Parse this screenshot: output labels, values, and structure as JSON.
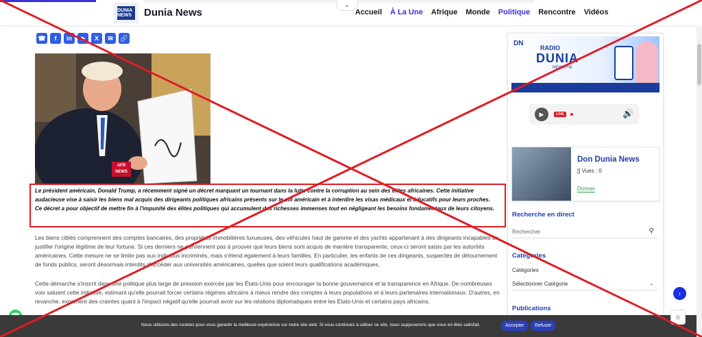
{
  "header": {
    "brand_name": "Dunia News",
    "logo_text": "DUNIA NEWS",
    "nav_items": [
      "Accueil",
      "À La Une",
      "Afrique",
      "Monde",
      "Politique",
      "Rencontre",
      "Vidéos"
    ],
    "active_items": [
      "À La Une",
      "Politique"
    ]
  },
  "share": {
    "icons": [
      "whatsapp-icon",
      "facebook-icon",
      "linkedin-icon",
      "telegram-icon",
      "x-icon",
      "email-icon",
      "link-icon"
    ]
  },
  "article": {
    "hero_badge": "AFR NEWS",
    "intro": "Le président américain, Donald Trump, a récemment signé un décret marquant un tournant dans la lutte contre la corruption au sein des élites africaines. Cette initiative audacieuse vise à saisir les biens mal acquis des dirigeants politiques africains présents sur le sol américain et à interdire les visas médicaux et éducatifs pour leurs proches. Ce décret a pour objectif de mettre fin à l'impunité des élites politiques qui accumulent des richesses immenses tout en négligeant les besoins fondamentaux de leurs citoyens.",
    "paragraph1": "Les biens ciblés comprennent des comptes bancaires, des propriétés immobilières luxueuses, des véhicules haut de gamme et des yachts appartenant à des dirigeants incapables de justifier l'origine légitime de leur fortune. Si ces derniers ne parviennent pas à prouver que leurs biens sont acquis de manière transparente, ceux-ci seront saisis par les autorités américaines. Cette mesure ne se limite pas aux individus incriminés, mais s'étend également à leurs familles. En particulier, les enfants de ces dirigeants, suspectés de détournement de fonds publics, seront désormais interdits d'accéder aux universités américaines, quelles que soient leurs qualifications académiques.",
    "paragraph2": "Cette démarche s'inscrit dans une politique plus large de pression exercée par les États-Unis pour encourager la bonne gouvernance et la transparence en Afrique. De nombreuses voix saluent cette initiative, estimant qu'elle pourrait forcer certains régimes africains à mieux rendre des comptes à leurs populations et à leurs partenaires internationaux. D'autres, en revanche, expriment des craintes quant à l'impact négatif qu'elle pourrait avoir sur les relations diplomatiques entre les États-Unis et certains pays africains."
  },
  "sidebar": {
    "banner": {
      "dn": "DN",
      "radio": "RADIO",
      "dunia": "DUNIA",
      "fm": "NEWS FM"
    },
    "player": {
      "live_label": "LIVE"
    },
    "don": {
      "title": "Don Dunia News",
      "views": "[] Vues : 0",
      "button": "Donner"
    },
    "search_heading": "Recherche en direct",
    "search_placeholder": "Rechercher",
    "categories_heading": "Catégories",
    "categories_label": "Catégories",
    "categories_select": "Sélectionner Catégorie",
    "publications_heading": "Publications"
  },
  "cookie": {
    "message": "Nous utilisons des cookies pour vous garantir la meilleure expérience sur notre site web. Si vous continuez à utiliser ce site, nous supposerons que vous en êtes satisfait.",
    "accept": "Accepter",
    "refuse": "Refuser"
  },
  "colors": {
    "accent": "#3b2fd6",
    "link_blue": "#1f3fa8",
    "overlay_red": "#e01c24",
    "cookie_bg": "#3a3a3a"
  }
}
